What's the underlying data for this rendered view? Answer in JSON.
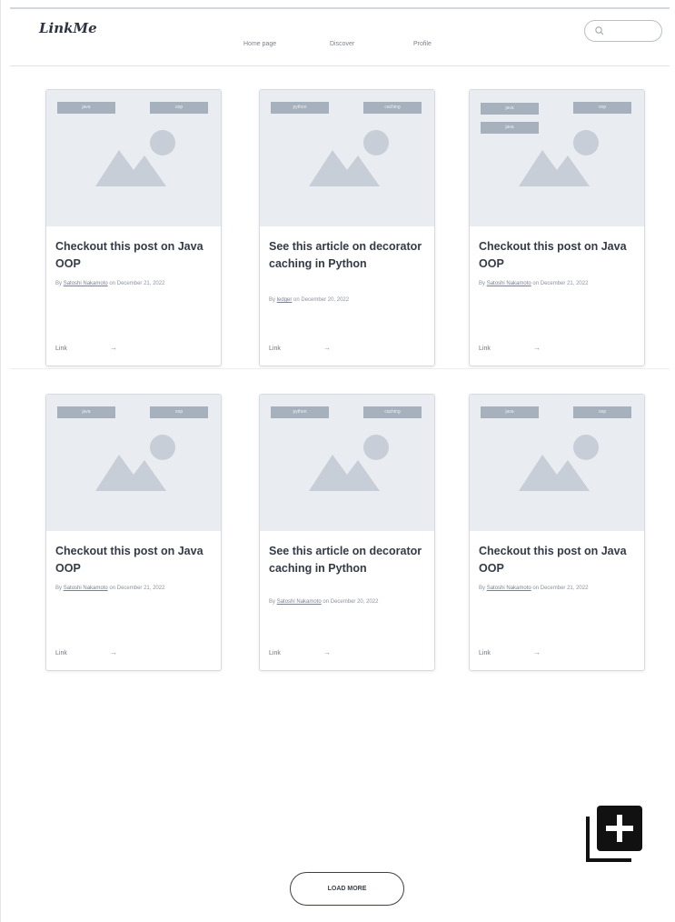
{
  "app": {
    "logo": "LinkMe"
  },
  "nav": {
    "items": [
      {
        "label": "Home page"
      },
      {
        "label": "Discover"
      },
      {
        "label": "Profile"
      }
    ]
  },
  "search": {
    "placeholder": "",
    "value": "",
    "icon": "search-icon"
  },
  "cards": [
    {
      "tags": [
        "java",
        "OOP"
      ],
      "title": "Checkout this post on Java OOP",
      "meta_prefix": "By",
      "author": "Satoshi Nakamoto",
      "meta_suffix": "on December 21, 2022",
      "link_label": "Link",
      "arrow": "→"
    },
    {
      "tags": [
        "PYTHON",
        "CACHING"
      ],
      "title": "See this article on decorator caching in Python",
      "meta_prefix": "By",
      "author": "ledger",
      "meta_suffix": "on December 20, 2022",
      "link_label": "Link",
      "arrow": "→"
    },
    {
      "tags": [
        "java",
        "OOP",
        "java"
      ],
      "title": "Checkout this post on Java OOP",
      "meta_prefix": "By",
      "author": "Satoshi Nakamoto",
      "meta_suffix": "on December 21, 2022",
      "link_label": "Link",
      "arrow": "→"
    },
    {
      "tags": [
        "java",
        "OOP"
      ],
      "title": "Checkout this post on Java OOP",
      "meta_prefix": "By",
      "author": "Satoshi Nakamoto",
      "meta_suffix": "on December 21, 2022",
      "link_label": "Link",
      "arrow": "→"
    },
    {
      "tags": [
        "PYTHON",
        "CACHING"
      ],
      "title": "See this article on decorator caching in Python",
      "meta_prefix": "By",
      "author": "Satoshi Nakamoto",
      "meta_suffix": "on December 20, 2022",
      "link_label": "Link",
      "arrow": "→"
    },
    {
      "tags": [
        "java",
        "OOP"
      ],
      "title": "Checkout this post on Java OOP",
      "meta_prefix": "By",
      "author": "Satoshi Nakamoto",
      "meta_suffix": "on December 21, 2022",
      "link_label": "Link",
      "arrow": "→"
    }
  ],
  "actions": {
    "add_icon": "add-to-collection-icon",
    "load_more_label": "LOAD MORE"
  },
  "colors": {
    "image_placeholder_bg": "#e9ecf1",
    "tag_bg": "#a7b0bd",
    "text_primary": "#343a46"
  }
}
